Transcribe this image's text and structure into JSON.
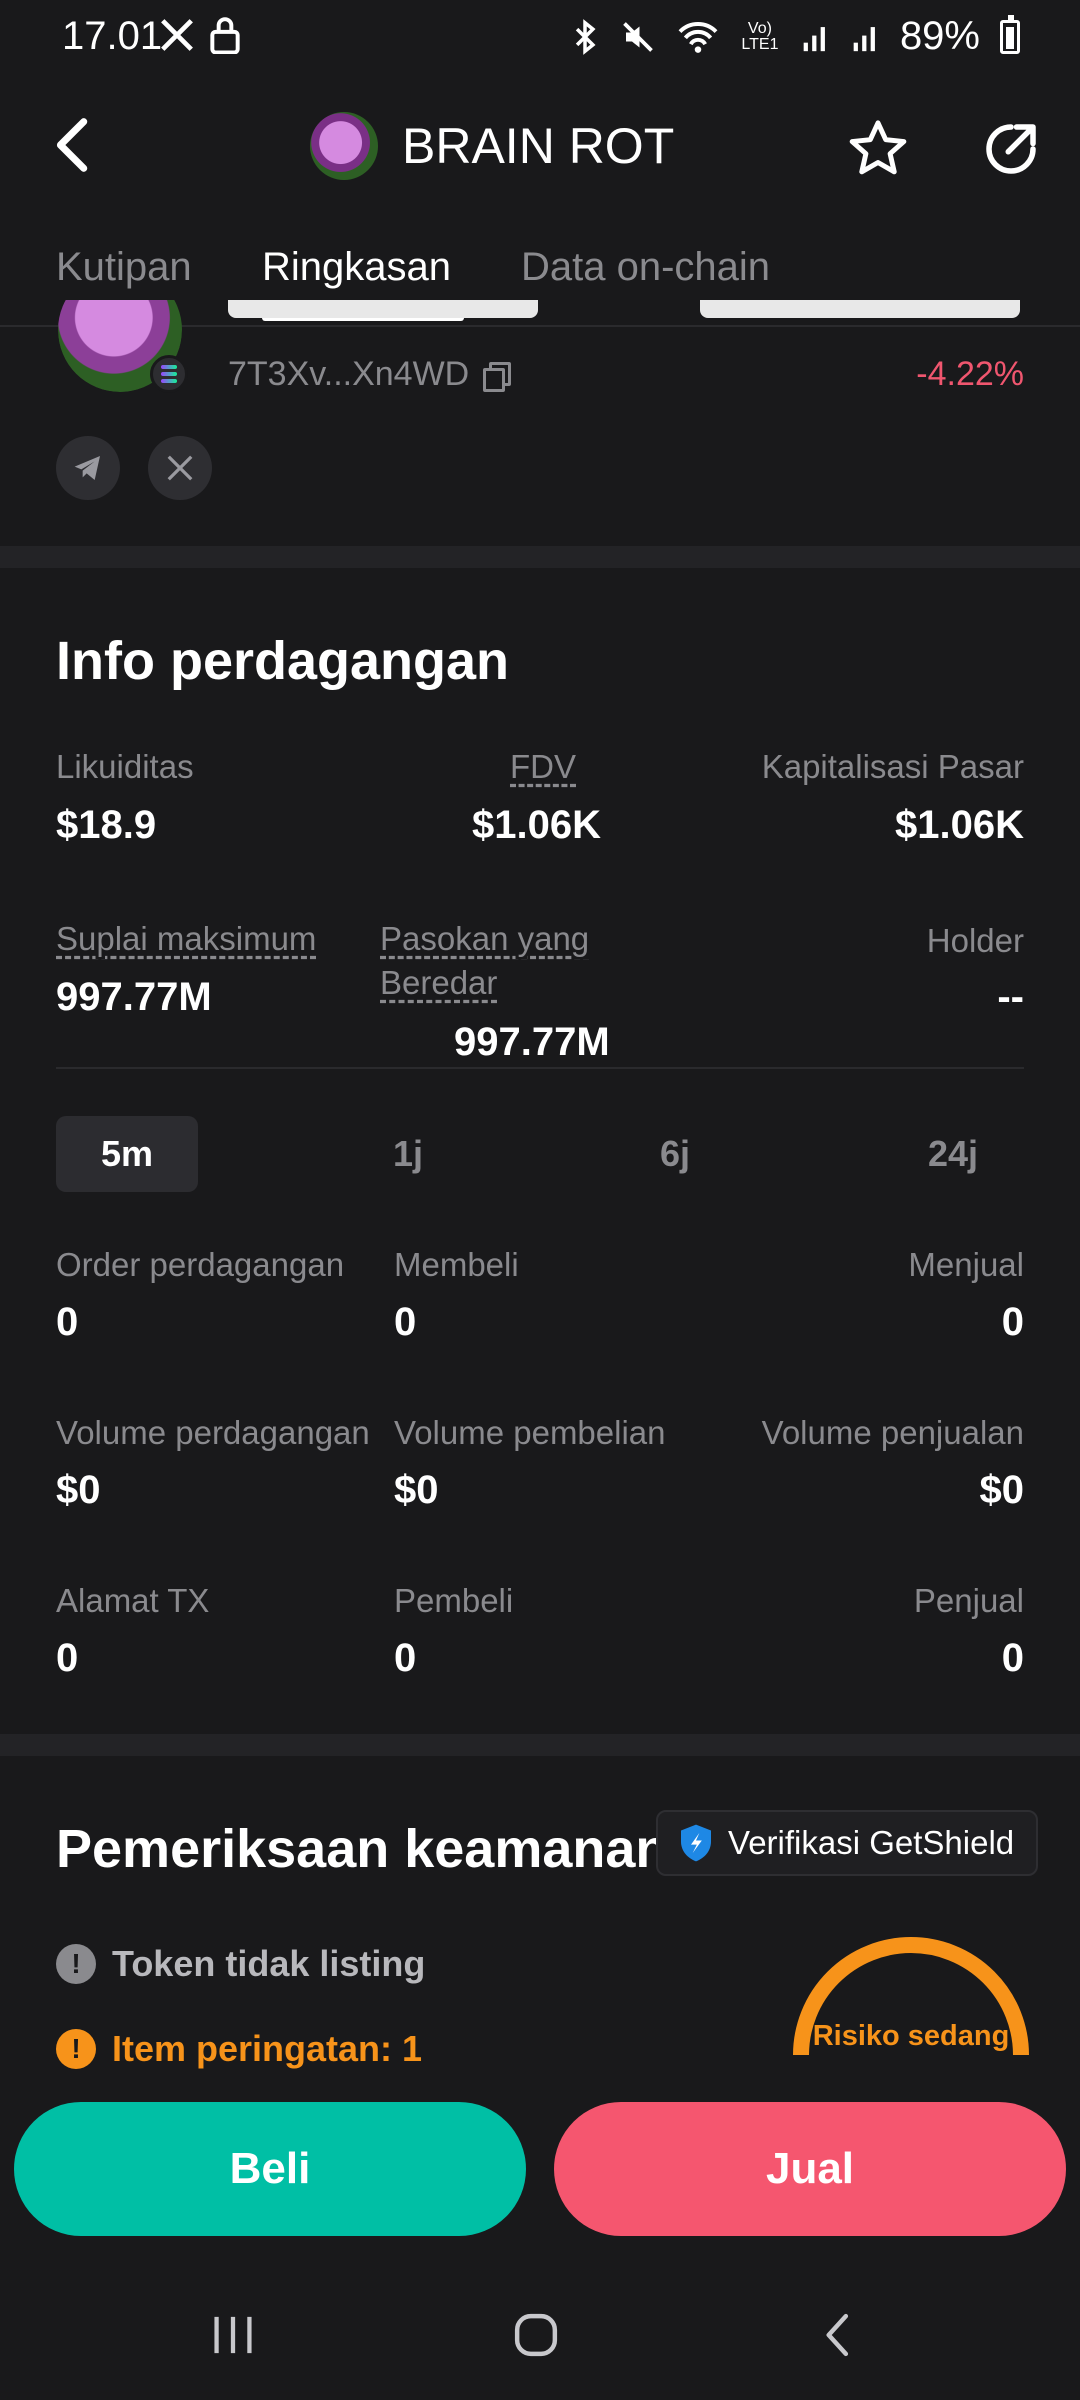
{
  "status_bar": {
    "time": "17.01",
    "battery": "89%",
    "network": "Vo) LTE1"
  },
  "header": {
    "title": "BRAIN ROT"
  },
  "tabs": [
    {
      "label": "Kutipan",
      "active": false
    },
    {
      "label": "Ringkasan",
      "active": true
    },
    {
      "label": "Data on-chain",
      "active": false
    }
  ],
  "token": {
    "address": "7T3Xv...Xn4WD",
    "change": "-4.22%"
  },
  "trade_info": {
    "heading": "Info perdagangan",
    "liquidity": {
      "label": "Likuiditas",
      "value": "$18.9"
    },
    "fdv": {
      "label": "FDV",
      "value": "$1.06K"
    },
    "market_cap": {
      "label": "Kapitalisasi Pasar",
      "value": "$1.06K"
    },
    "max_supply": {
      "label": "Suplai maksimum",
      "value": "997.77M"
    },
    "circulating": {
      "label_line1": "Pasokan yang",
      "label_line2": "Beredar",
      "value": "997.77M"
    },
    "holder": {
      "label": "Holder",
      "value": "--"
    },
    "periods": [
      "5m",
      "1j",
      "6j",
      "24j"
    ],
    "active_period": "5m",
    "stats": {
      "trade_orders": {
        "label": "Order perdagangan",
        "value": "0"
      },
      "buys": {
        "label": "Membeli",
        "value": "0"
      },
      "sells": {
        "label": "Menjual",
        "value": "0"
      },
      "trade_volume": {
        "label": "Volume perdagangan",
        "value": "$0"
      },
      "buy_volume": {
        "label": "Volume pembelian",
        "value": "$0"
      },
      "sell_volume": {
        "label": "Volume penjualan",
        "value": "$0"
      },
      "tx_address": {
        "label": "Alamat TX",
        "value": "0"
      },
      "buyers": {
        "label": "Pembeli",
        "value": "0"
      },
      "sellers": {
        "label": "Penjual",
        "value": "0"
      }
    }
  },
  "security": {
    "heading": "Pemeriksaan keamanan",
    "verify_label": "Verifikasi GetShield",
    "not_listed": "Token tidak listing",
    "warnings": "Item peringatan: 1",
    "risk_label": "Risiko sedang",
    "colors": {
      "warning": "#f7931a",
      "neutral": "#8a8a8e"
    }
  },
  "actions": {
    "buy": "Beli",
    "sell": "Jual"
  },
  "colors": {
    "buy": "#00bfa5",
    "sell": "#f5566f",
    "negative": "#f0566f",
    "background": "#19191b"
  }
}
